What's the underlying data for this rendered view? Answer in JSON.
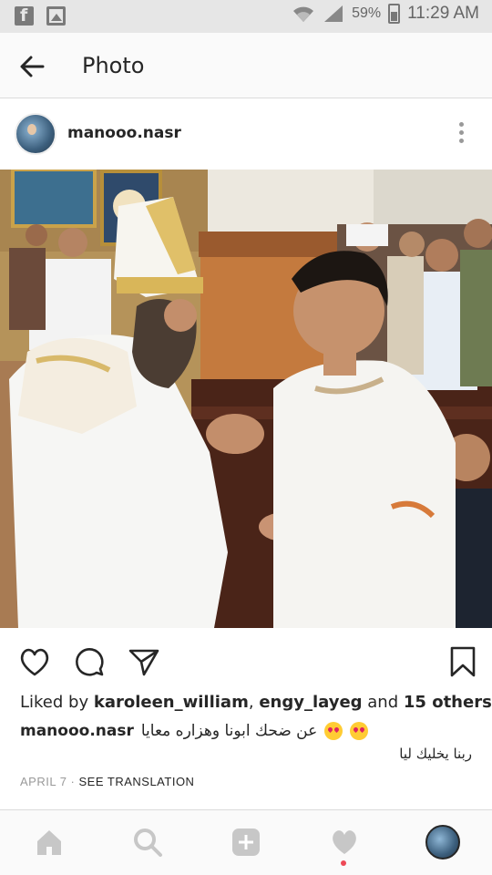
{
  "status_bar": {
    "battery_percent": "59%",
    "time": "11:29 AM",
    "icons": [
      "facebook-icon",
      "gallery-icon",
      "wifi-icon",
      "signal-icon",
      "battery-icon"
    ]
  },
  "header": {
    "title": "Photo"
  },
  "post": {
    "username": "manooo.nasr",
    "likes": {
      "prefix": "Liked by",
      "user1": "karoleen_william",
      "separator": ",",
      "user2": "engy_layeg",
      "and": "and",
      "others": "15 others"
    },
    "caption": {
      "username": "manooo.nasr",
      "text": "عن ضحك ابونا وهزاره معايا"
    },
    "comment": "ربنا يخليك ليا",
    "date": "APRIL 7",
    "translate_label": "SEE TRANSLATION"
  },
  "actions": [
    "heart-icon",
    "comment-icon",
    "share-icon",
    "bookmark-icon"
  ],
  "bottom_nav": [
    "home-icon",
    "search-icon",
    "add-icon",
    "activity-icon",
    "profile-avatar"
  ],
  "colors": {
    "status_bar_bg": "#e6e6e6",
    "header_bg": "#fafafa",
    "text": "#262626",
    "muted": "#999999",
    "notification_dot": "#ed4956"
  }
}
